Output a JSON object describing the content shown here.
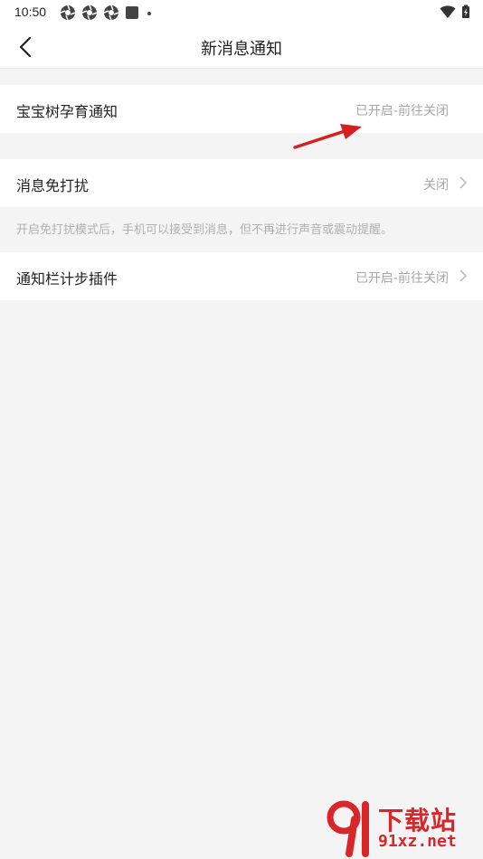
{
  "status_bar": {
    "time": "10:50"
  },
  "header": {
    "title": "新消息通知"
  },
  "rows": [
    {
      "label": "宝宝树孕育通知",
      "value": "已开启-前往关闭"
    },
    {
      "label": "消息免打扰",
      "value": "关闭"
    },
    {
      "label": "通知栏计步插件",
      "value": "已开启-前往关闭"
    }
  ],
  "dnd_description": "开启免打扰模式后，手机可以接受到消息，但不再进行声音或震动提醒。",
  "watermark": {
    "big": "下载站",
    "small": "91xz.net"
  },
  "colors": {
    "annotation_arrow": "#d42020",
    "watermark": "#d9262b"
  }
}
